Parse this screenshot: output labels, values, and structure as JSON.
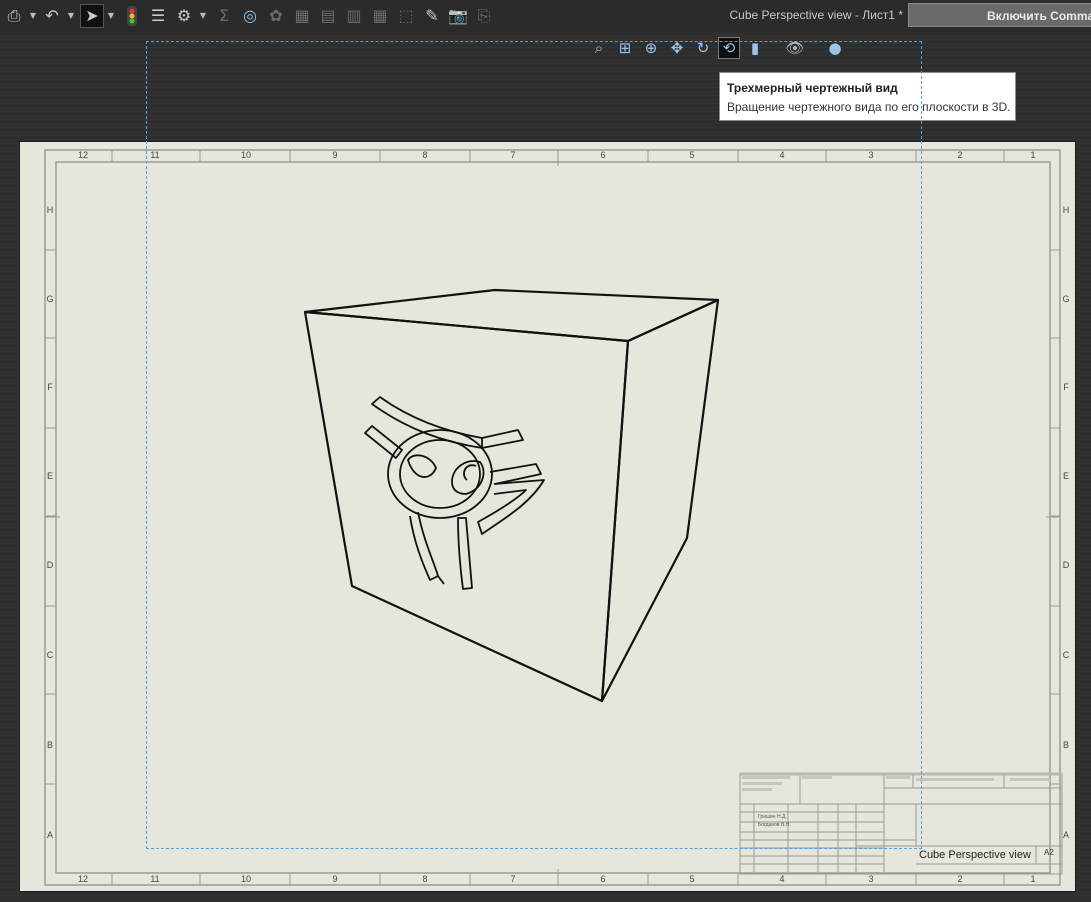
{
  "toolbar": {
    "icons": [
      "print-icon",
      "undo-icon",
      "select-cursor-icon",
      "traffic-light-icon",
      "properties-icon",
      "settings-icon",
      "sum-icon",
      "smart-dimension-icon",
      "balloon-icon",
      "table-icon",
      "table-icon",
      "table-icon",
      "table-icon",
      "component-icon",
      "pen-icon",
      "camera-icon",
      "export-icon"
    ],
    "document_title": "Cube Perspective view - Лист1 *",
    "command_box": "Включить Comma"
  },
  "view_toolbar": {
    "icons": [
      "zoom-to-fit-icon",
      "zoom-window-icon",
      "zoom-in-out-icon",
      "pan-icon",
      "rotate-icon",
      "3d-drawing-view-icon",
      "display-style-icon",
      "hide-show-icon",
      "appearance-icon"
    ]
  },
  "tooltip": {
    "title": "Трехмерный чертежный вид",
    "description": "Вращение чертежного вида по его плоскости в 3D."
  },
  "sheet": {
    "columns": [
      "12",
      "11",
      "10",
      "9",
      "8",
      "7",
      "6",
      "5",
      "4",
      "3",
      "2",
      "1"
    ],
    "rows": [
      "H",
      "G",
      "F",
      "E",
      "D",
      "C",
      "B",
      "A"
    ],
    "title_block": {
      "drawing_title": "Cube Perspective view",
      "sheet_size": "A2",
      "drawn_by": "Гришин Н.Д.",
      "checked_by": "Богданов В.Н."
    }
  },
  "colors": {
    "paper": "#e6e6dc",
    "selection": "#4aa3e0",
    "tooltip_bg": "#ffffff"
  }
}
